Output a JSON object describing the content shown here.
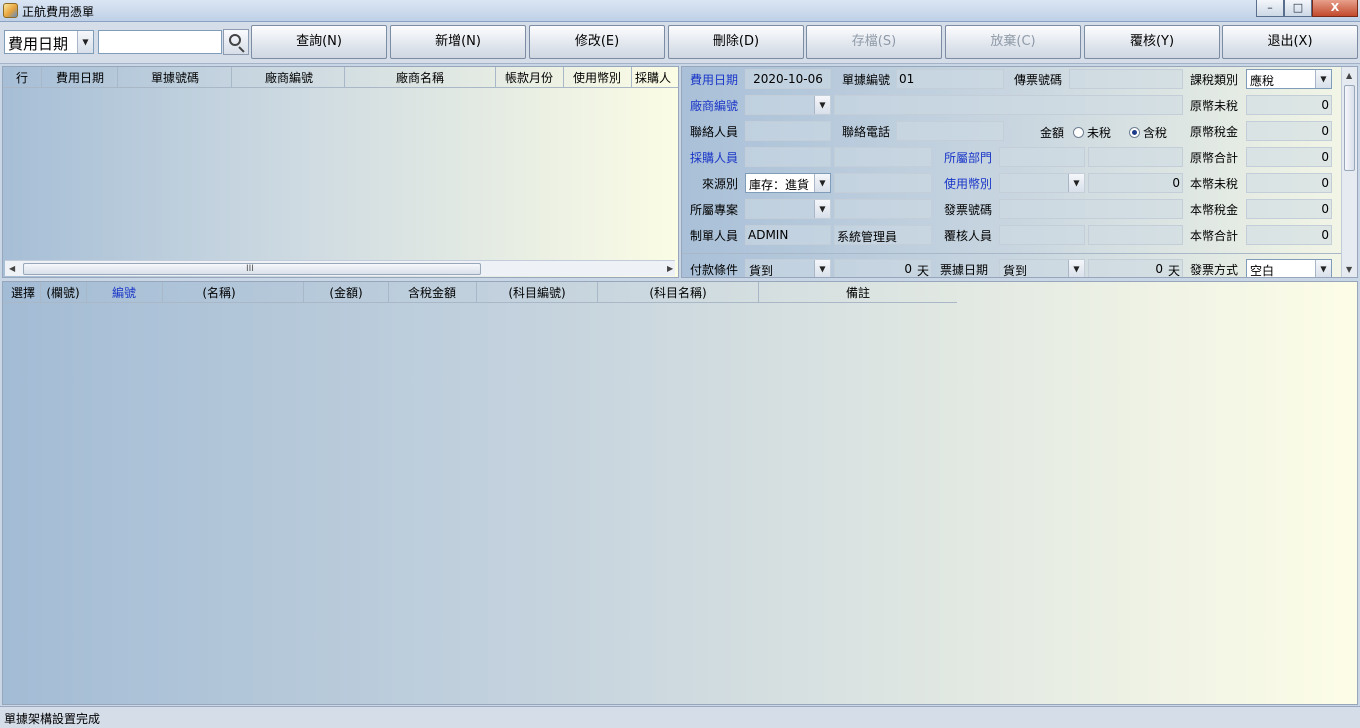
{
  "window": {
    "title": "正航費用憑單",
    "buttons": {
      "minimize": "–",
      "restore": "□",
      "close": "X"
    }
  },
  "toolbar": {
    "field_select": "費用日期",
    "search_value": "",
    "buttons": [
      "查詢(N)",
      "新增(N)",
      "修改(E)",
      "刪除(D)",
      "存檔(S)",
      "放棄(C)",
      "覆核(Y)",
      "退出(X)"
    ]
  },
  "list_grid": {
    "columns": [
      "行",
      "費用日期",
      "單據號碼",
      "廠商編號",
      "廠商名稱",
      "帳款月份",
      "使用幣別",
      "採購人"
    ],
    "hscroll_grip": "III"
  },
  "form": {
    "fee_date_label": "費用日期",
    "fee_date": "2020-10-06",
    "doc_no_label": "單據編號",
    "doc_no": "01",
    "voucher_no_label": "傳票號碼",
    "voucher_no": "",
    "tax_type_label": "課稅類別",
    "tax_type": "應稅",
    "vendor_no_label": "廠商編號",
    "vendor_no": "",
    "vendor_name": "",
    "orig_untaxed_label": "原幣未稅",
    "orig_untaxed": "0",
    "contact_label": "聯絡人員",
    "contact": "",
    "phone_label": "聯絡電話",
    "phone": "",
    "amount_label": "金額",
    "amount_untaxed_option": "未稅",
    "amount_taxed_option": "含稅",
    "orig_tax_label": "原幣稅金",
    "orig_tax": "0",
    "purchaser_label": "採購人員",
    "purchaser_id": "",
    "purchaser_name": "",
    "dept_label": "所屬部門",
    "dept_id": "",
    "dept_name": "",
    "orig_total_label": "原幣合計",
    "orig_total": "0",
    "source_label": "來源別",
    "source": "庫存：進貨",
    "source_extra": "",
    "currency_label": "使用幣別",
    "currency": "",
    "exchange_rate": "0",
    "local_untaxed_label": "本幣未稅",
    "local_untaxed": "0",
    "project_label": "所屬專案",
    "project_id": "",
    "project_name": "",
    "invoice_no_label": "發票號碼",
    "invoice_no": "",
    "local_tax_label": "本幣稅金",
    "local_tax": "0",
    "creator_label": "制單人員",
    "creator": "ADMIN",
    "creator_name": "系統管理員",
    "reviewer_label": "覆核人員",
    "reviewer_id": "",
    "reviewer_name": "",
    "local_total_label": "本幣合計",
    "local_total": "0",
    "payment_terms_label": "付款條件",
    "payment_terms": "貨到",
    "payment_days": "0",
    "days_unit": "天",
    "bill_date_label": "票據日期",
    "bill_date_terms": "貨到",
    "bill_days": "0",
    "invoice_method_label": "發票方式",
    "invoice_method": "空白"
  },
  "detail_grid": {
    "columns": [
      "選擇",
      "(欄號)",
      "編號",
      "(名稱)",
      "(金額)",
      "含稅金額",
      "(科目編號)",
      "(科目名稱)",
      "備註"
    ]
  },
  "status": "單據架構設置完成"
}
